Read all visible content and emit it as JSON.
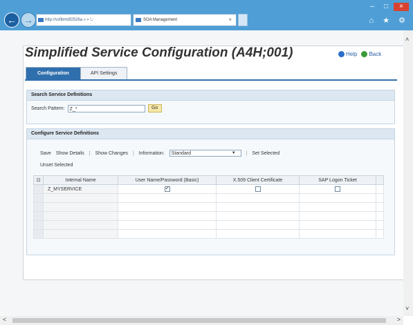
{
  "browser": {
    "address_url": "http://vsfibmdf2526a",
    "address_controls": "⌕ ▾ ↻",
    "tab_title": "SOA Management",
    "tab_close": "×",
    "window_controls": {
      "minimize": "–",
      "maximize": "□",
      "close": "×"
    },
    "tools_icons": "⌂ ★ ⚙"
  },
  "page": {
    "title": "Simplified Service Configuration (A4H;001)",
    "help_label": "Help",
    "back_label": "Back"
  },
  "tabs": [
    {
      "label": "Configuration",
      "active": true
    },
    {
      "label": "API Settings",
      "active": false
    }
  ],
  "search_group": {
    "heading": "Search Service Definitions",
    "pattern_label": "Search Pattern:",
    "pattern_value": "Z_*",
    "go_label": "Go"
  },
  "configure_group": {
    "heading": "Configure Service Definitions",
    "toolbar": {
      "save": "Save",
      "show_details": "Show Details",
      "show_changes": "Show Changes",
      "information_label": "Information:",
      "information_value": "Standard",
      "set_selected": "Set Selected",
      "unset_selected": "Unset Selected"
    },
    "table": {
      "columns": [
        "Internal Name",
        "User Name/Password (Basic)",
        "X.509 Client Certificate",
        "SAP Logon Ticket"
      ],
      "rows": [
        {
          "internal_name": "Z_MYSERVICE",
          "basic": true,
          "x509": false,
          "sap_logon": false
        }
      ]
    }
  },
  "scrollbars": {
    "up": "˄",
    "down": "˅",
    "left": "<",
    "right": ">"
  }
}
